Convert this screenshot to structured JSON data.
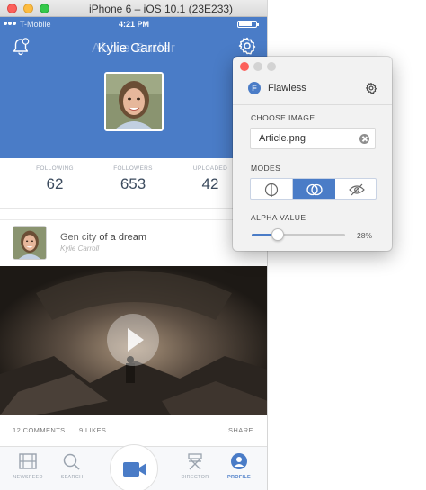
{
  "simulator": {
    "window_title": "iPhone 6 – iOS 10.1 (23E233)"
  },
  "status_bar": {
    "carrier": "T-Mobile",
    "time": "4:21 PM"
  },
  "profile": {
    "name": "Kylie Carroll",
    "name_ghost": "Abbie Butler"
  },
  "stats": [
    {
      "label": "FOLLOWING",
      "value": "62"
    },
    {
      "label": "FOLLOWERS",
      "value": "653"
    },
    {
      "label": "UPLOADED",
      "value": "42"
    }
  ],
  "post": {
    "title_prefix": "Gen city",
    "title": "of a dream",
    "subtitle": "Kylie Carroll"
  },
  "post_meta": {
    "comments": "12 COMMENTS",
    "likes": "9 LIKES",
    "share": "SHARE"
  },
  "tabbar": {
    "items": [
      {
        "label": "NEWSFEED",
        "icon": "film-icon"
      },
      {
        "label": "SEARCH",
        "icon": "search-icon"
      },
      {
        "label": "",
        "icon": "video-camera-icon"
      },
      {
        "label": "DIRECTOR",
        "icon": "director-chair-icon"
      },
      {
        "label": "PROFILE",
        "icon": "profile-icon"
      }
    ],
    "active": "PROFILE"
  },
  "flawless_panel": {
    "app_name": "Flawless",
    "choose_image_label": "CHOOSE IMAGE",
    "image_value": "Article.png",
    "modes_label": "MODES",
    "modes": [
      "split-mode-icon",
      "overlay-mode-icon",
      "hidden-mode-icon"
    ],
    "active_mode": 1,
    "alpha_label": "ALPHA VALUE",
    "alpha_value": 0.28,
    "alpha_text": "28%"
  },
  "colors": {
    "accent": "#4a7cc7",
    "close": "#fc605b"
  }
}
